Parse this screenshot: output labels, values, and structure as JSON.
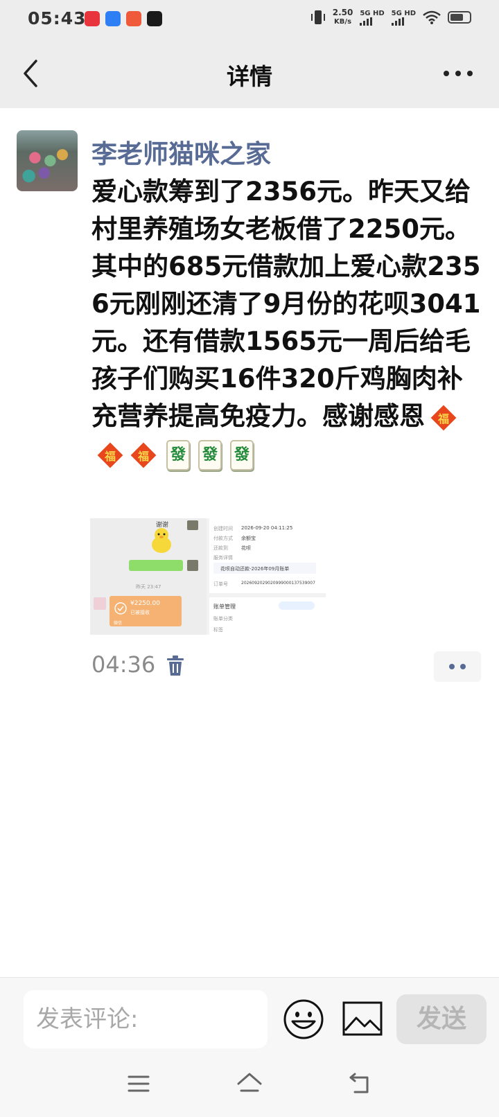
{
  "status_bar": {
    "time": "05:43",
    "net_speed_value": "2.50",
    "net_speed_unit": "KB/s",
    "sim1_label": "5G HD",
    "sim2_label": "5G HD",
    "app_icon_colors": [
      "#e8343c",
      "#2d7ff3",
      "#ef5a3a",
      "#1a1a1a"
    ]
  },
  "nav": {
    "title": "详情",
    "back_icon": "chevron-left-icon",
    "more_icon": "more-dots-icon"
  },
  "post": {
    "author": "李老师猫咪之家",
    "body": "爱心款筹到了2356元。昨天又给村里养殖场女老板借了2250元。其中的685元借款加上爱心款2356元刚刚还清了9月份的花呗3041元。还有借款1565元一周后给毛孩子们购买16件320斤鸡胸肉补充营养提高免疫力。感谢感恩",
    "emojis": [
      "fu-emoji",
      "fu-emoji",
      "fu-emoji",
      "fa-emoji",
      "fa-emoji",
      "fa-emoji"
    ],
    "fa_char": "發",
    "time": "04:36",
    "image": {
      "left_thanks": "谢谢",
      "left_time": "昨天 23:47",
      "left_amount": "¥2250.00",
      "left_status": "已被接收",
      "left_bottom": "微信",
      "right_rows": [
        {
          "label": "创建时间",
          "value": "2026-09-20 04:11:25"
        },
        {
          "label": "付款方式",
          "value": "余额宝"
        },
        {
          "label": "还款到",
          "value": "花呗"
        },
        {
          "label": "服务详情",
          "value": ""
        },
        {
          "label": "",
          "value": "花呗自动还款-2026年09月账单"
        },
        {
          "label": "订单号",
          "value": "2026092029020999000137539007"
        }
      ],
      "right_section": "账单管理",
      "right_row2": "账单分类",
      "right_row3": "标签"
    }
  },
  "comment": {
    "placeholder": "发表评论:",
    "send_label": "发送"
  },
  "accent_color": "#576b95"
}
